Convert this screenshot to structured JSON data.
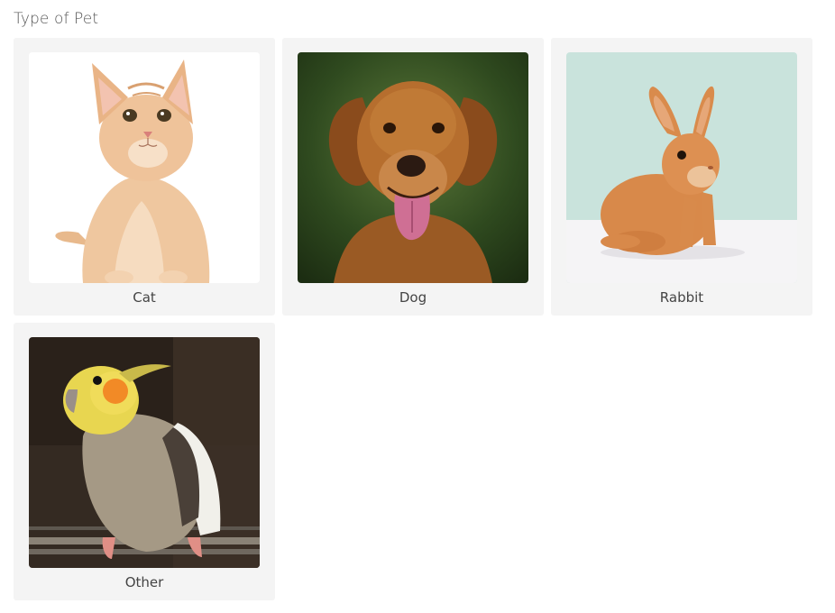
{
  "question": {
    "title": "Type of Pet"
  },
  "options": [
    {
      "label": "Cat",
      "image": "cat-photo"
    },
    {
      "label": "Dog",
      "image": "dog-photo"
    },
    {
      "label": "Rabbit",
      "image": "rabbit-photo"
    },
    {
      "label": "Other",
      "image": "cockatiel-photo"
    }
  ],
  "colors": {
    "card_background": "#f4f4f4",
    "text": "#444444"
  }
}
